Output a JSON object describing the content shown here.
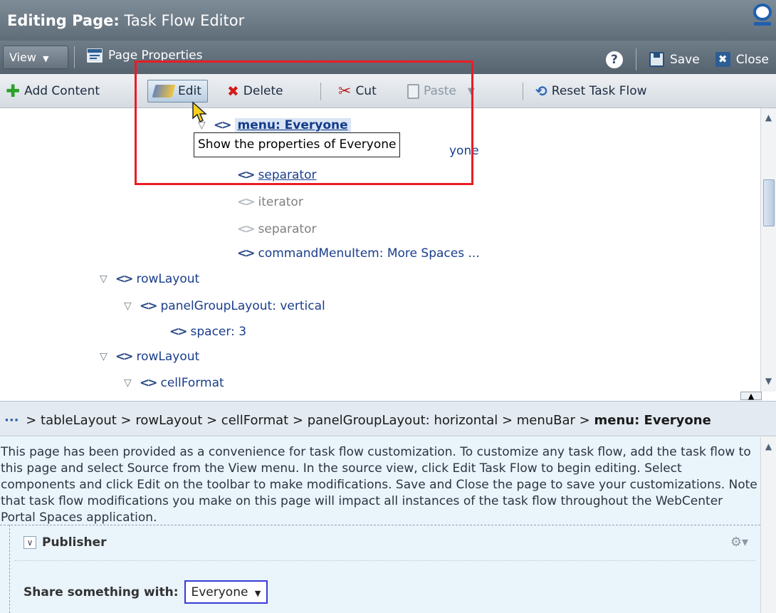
{
  "window": {
    "title_bold": "Editing Page:",
    "title_rest": "Task Flow Editor"
  },
  "menubar": {
    "view_label": "View",
    "page_properties_label": "Page Properties",
    "save_label": "Save",
    "close_label": "Close",
    "help_glyph": "?"
  },
  "toolbar": {
    "add_content_label": "Add Content",
    "edit_label": "Edit",
    "delete_label": "Delete",
    "cut_label": "Cut",
    "paste_label": "Paste",
    "reset_label": "Reset Task Flow"
  },
  "tree": {
    "nodes": [
      {
        "label": "menu: Everyone"
      },
      {
        "label": "yone"
      },
      {
        "label": "separator"
      },
      {
        "label": "iterator"
      },
      {
        "label": "separator"
      },
      {
        "label": "commandMenuItem: More Spaces ..."
      },
      {
        "label": "rowLayout"
      },
      {
        "label": "panelGroupLayout: vertical"
      },
      {
        "label": "spacer: 3"
      },
      {
        "label": "rowLayout"
      },
      {
        "label": "cellFormat"
      }
    ],
    "tooltip": "Show the properties of Everyone"
  },
  "breadcrumb": {
    "ellipsis": "···",
    "path": " > tableLayout > rowLayout > cellFormat > panelGroupLayout: horizontal > menuBar > ",
    "current": "menu: Everyone"
  },
  "description": "This page has been provided as a convenience for task flow customization. To customize any task flow, add the task flow to this page and select Source from the View menu. In the source view, click Edit Task Flow to begin editing. Select components and click Edit on the toolbar to make modifications. Save and Close the page to save your customizations. Note that task flow modifications you make on this page will impact all instances of the task flow throughout the WebCenter Portal Spaces application.",
  "publisher": {
    "title": "Publisher",
    "share_label": "Share something with:",
    "share_value": "Everyone"
  },
  "colors": {
    "highlight_box": "#ea1c24",
    "title_bar": "#6f7d89",
    "toolbar": "#dfe4e9",
    "bottom_panel": "#eaf4fb"
  }
}
